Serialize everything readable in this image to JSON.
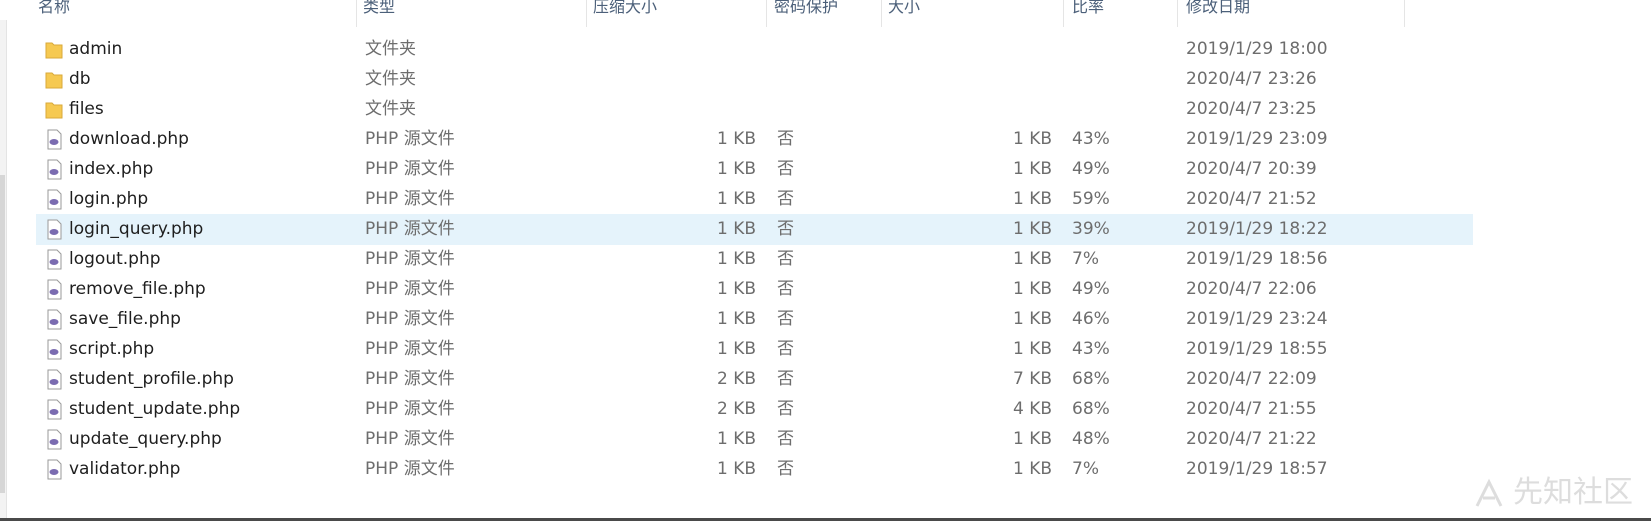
{
  "columns": [
    "名称",
    "类型",
    "压缩大小",
    "密码保护",
    "大小",
    "比率",
    "修改日期"
  ],
  "rows": [
    {
      "name": "admin",
      "icon": "folder-icon",
      "type": "文件夹",
      "packed": "",
      "protected": "",
      "size": "",
      "ratio": "",
      "modified": "2019/1/29 18:00"
    },
    {
      "name": "db",
      "icon": "folder-icon",
      "type": "文件夹",
      "packed": "",
      "protected": "",
      "size": "",
      "ratio": "",
      "modified": "2020/4/7 23:26"
    },
    {
      "name": "files",
      "icon": "folder-icon",
      "type": "文件夹",
      "packed": "",
      "protected": "",
      "size": "",
      "ratio": "",
      "modified": "2020/4/7 23:25"
    },
    {
      "name": "download.php",
      "icon": "php-file-icon",
      "type": "PHP 源文件",
      "packed": "1 KB",
      "protected": "否",
      "size": "1 KB",
      "ratio": "43%",
      "modified": "2019/1/29 23:09"
    },
    {
      "name": "index.php",
      "icon": "php-file-icon",
      "type": "PHP 源文件",
      "packed": "1 KB",
      "protected": "否",
      "size": "1 KB",
      "ratio": "49%",
      "modified": "2020/4/7 20:39"
    },
    {
      "name": "login.php",
      "icon": "php-file-icon",
      "type": "PHP 源文件",
      "packed": "1 KB",
      "protected": "否",
      "size": "1 KB",
      "ratio": "59%",
      "modified": "2020/4/7 21:52"
    },
    {
      "name": "login_query.php",
      "icon": "php-file-icon",
      "type": "PHP 源文件",
      "packed": "1 KB",
      "protected": "否",
      "size": "1 KB",
      "ratio": "39%",
      "modified": "2019/1/29 18:22",
      "selected": true
    },
    {
      "name": "logout.php",
      "icon": "php-file-icon",
      "type": "PHP 源文件",
      "packed": "1 KB",
      "protected": "否",
      "size": "1 KB",
      "ratio": "7%",
      "modified": "2019/1/29 18:56"
    },
    {
      "name": "remove_file.php",
      "icon": "php-file-icon",
      "type": "PHP 源文件",
      "packed": "1 KB",
      "protected": "否",
      "size": "1 KB",
      "ratio": "49%",
      "modified": "2020/4/7 22:06"
    },
    {
      "name": "save_file.php",
      "icon": "php-file-icon",
      "type": "PHP 源文件",
      "packed": "1 KB",
      "protected": "否",
      "size": "1 KB",
      "ratio": "46%",
      "modified": "2019/1/29 23:24"
    },
    {
      "name": "script.php",
      "icon": "php-file-icon",
      "type": "PHP 源文件",
      "packed": "1 KB",
      "protected": "否",
      "size": "1 KB",
      "ratio": "43%",
      "modified": "2019/1/29 18:55"
    },
    {
      "name": "student_profile.php",
      "icon": "php-file-icon",
      "type": "PHP 源文件",
      "packed": "2 KB",
      "protected": "否",
      "size": "7 KB",
      "ratio": "68%",
      "modified": "2020/4/7 22:09"
    },
    {
      "name": "student_update.php",
      "icon": "php-file-icon",
      "type": "PHP 源文件",
      "packed": "2 KB",
      "protected": "否",
      "size": "4 KB",
      "ratio": "68%",
      "modified": "2020/4/7 21:55"
    },
    {
      "name": "update_query.php",
      "icon": "php-file-icon",
      "type": "PHP 源文件",
      "packed": "1 KB",
      "protected": "否",
      "size": "1 KB",
      "ratio": "48%",
      "modified": "2020/4/7 21:22"
    },
    {
      "name": "validator.php",
      "icon": "php-file-icon",
      "type": "PHP 源文件",
      "packed": "1 KB",
      "protected": "否",
      "size": "1 KB",
      "ratio": "7%",
      "modified": "2019/1/29 18:57"
    }
  ],
  "watermark": "先知社区",
  "colors": {
    "selected_row": "#e5f3fb",
    "folder": "#f6c951",
    "php_icon": "#7a6bb0"
  }
}
